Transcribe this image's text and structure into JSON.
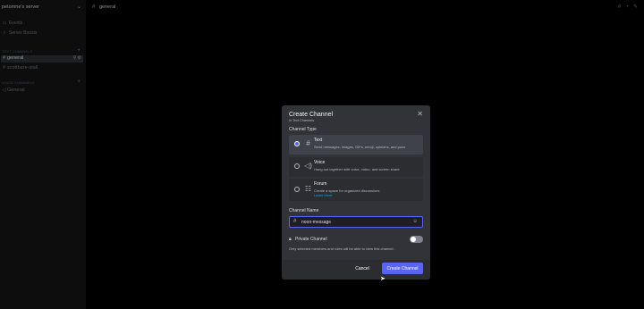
{
  "server": {
    "name": "petomne's server"
  },
  "sidebar": {
    "nav_items": [
      {
        "icon": "calendar-icon",
        "label": "Events"
      },
      {
        "icon": "boosts-icon",
        "label": "Server Boosts"
      }
    ],
    "categories": [
      {
        "label": "Text Channels",
        "channels": [
          {
            "label": "general",
            "active": true
          },
          {
            "label": "scottbare-stall",
            "active": false
          }
        ]
      },
      {
        "label": "Voice Channels",
        "channels": [
          {
            "label": "General",
            "active": false
          }
        ]
      }
    ]
  },
  "topbar": {
    "channel": "general"
  },
  "modal": {
    "title": "Create Channel",
    "subtitle": "in Text Channels",
    "channel_type_label": "Channel Type",
    "options": [
      {
        "icon": "text-channel-icon",
        "name": "Text",
        "desc": "Send messages, images, GIFs, emoji, opinions, and puns",
        "selected": true
      },
      {
        "icon": "voice-channel-icon",
        "name": "Voice",
        "desc": "Hang out together with voice, video, and screen share",
        "selected": false
      },
      {
        "icon": "forum-channel-icon",
        "name": "Forum",
        "desc": "Create a space for organized discussions",
        "link": "Learn More",
        "selected": false
      }
    ],
    "name_label": "Channel Name",
    "name_value": "noon-message",
    "private_label": "Private Channel",
    "private_desc": "Only selected members and roles will be able to view this channel.",
    "private_enabled": false,
    "cancel_label": "Cancel",
    "create_label": "Create Channel"
  },
  "colors": {
    "accent": "#5865f2",
    "modal_bg": "#313338",
    "link": "#00a8fc"
  }
}
